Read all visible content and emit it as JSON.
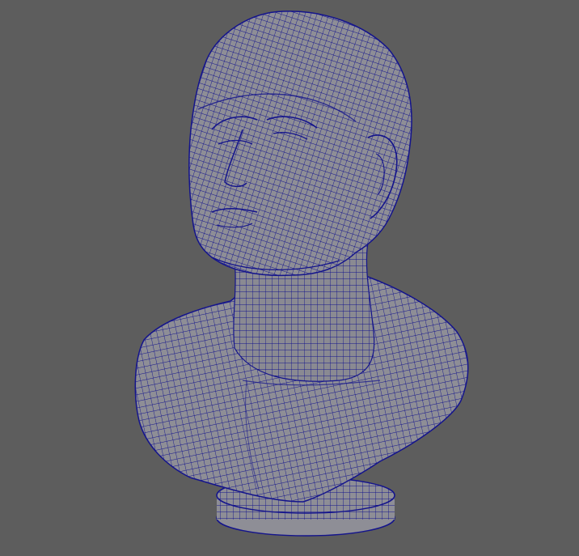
{
  "viewport": {
    "background_color": "#5d5d5d",
    "mesh_fill_color": "#8e8e96",
    "mesh_shade_color": "#7a7a84",
    "wire_color": "#14148c",
    "shading_mode": "wireframe-on-shaded",
    "subject": "bust-mesh"
  }
}
